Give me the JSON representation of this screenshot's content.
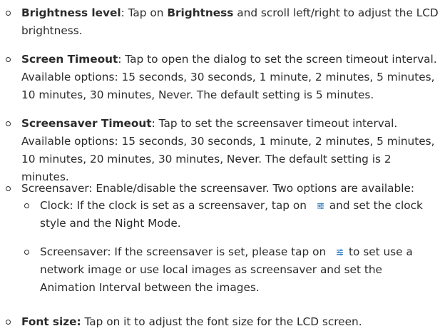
{
  "items": [
    {
      "title": "Brightness level",
      "sep": ": Tap on ",
      "inline_bold": "Brightness",
      "rest": " and scroll left/right to adjust the LCD brightness."
    },
    {
      "title": "Screen Timeout",
      "text": ": Tap to open the dialog to set the screen timeout interval. Available options: 15 seconds, 30 seconds, 1 minute, 2 minutes, 5 minutes, 10 minutes, 30 minutes, Never. The default setting is 5 minutes."
    },
    {
      "title": "Screensaver Timeout",
      "text": ": Tap to set the screensaver timeout interval. Available options: 15 seconds, 30 seconds, 1 minute, 2 minutes, 5 minutes, 10 minutes, 20 minutes, 30 minutes, Never. The default setting is 2 minutes."
    },
    {
      "text": "Screensaver: Enable/disable the screensaver. Two options are available:",
      "subitems": [
        {
          "before": "Clock: If the clock is set as a screensaver, tap on",
          "after": "and set the clock style and the Night Mode."
        },
        {
          "before": "Screensaver: If the screensaver is set, please tap on",
          "after": "to set use a network image or use local images as screensaver and set the Animation Interval between the images."
        }
      ]
    },
    {
      "title": "Font size:",
      "text": " Tap on it to adjust the font size for the LCD screen."
    }
  ],
  "icon_color": "#3b82c4"
}
